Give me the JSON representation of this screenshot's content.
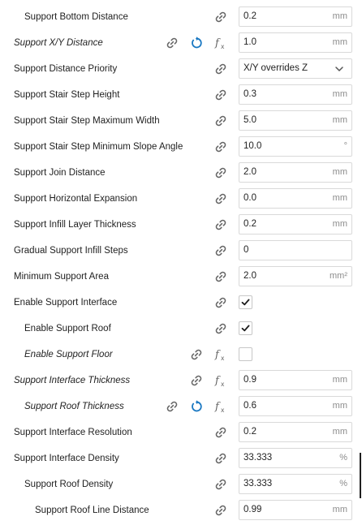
{
  "settings": [
    {
      "label": "Support Bottom Distance",
      "indent": 1,
      "italic": false,
      "icons": [
        "link"
      ],
      "control": "number",
      "value": "0.2",
      "unit": "mm"
    },
    {
      "label": "Support X/Y Distance",
      "indent": 0,
      "italic": true,
      "icons": [
        "per-extruder",
        "reset",
        "formula",
        "link"
      ],
      "control": "number",
      "value": "1.0",
      "unit": "mm"
    },
    {
      "label": "Support Distance Priority",
      "indent": 0,
      "italic": false,
      "icons": [
        "link"
      ],
      "control": "select",
      "value": "X/Y overrides Z",
      "unit": ""
    },
    {
      "label": "Support Stair Step Height",
      "indent": 0,
      "italic": false,
      "icons": [
        "link"
      ],
      "control": "number",
      "value": "0.3",
      "unit": "mm"
    },
    {
      "label": "Support Stair Step Maximum Width",
      "indent": 0,
      "italic": false,
      "icons": [
        "link"
      ],
      "control": "number",
      "value": "5.0",
      "unit": "mm"
    },
    {
      "label": "Support Stair Step Minimum Slope Angle",
      "indent": 0,
      "italic": false,
      "icons": [
        "link"
      ],
      "control": "number",
      "value": "10.0",
      "unit": "°"
    },
    {
      "label": "Support Join Distance",
      "indent": 0,
      "italic": false,
      "icons": [
        "link"
      ],
      "control": "number",
      "value": "2.0",
      "unit": "mm"
    },
    {
      "label": "Support Horizontal Expansion",
      "indent": 0,
      "italic": false,
      "icons": [
        "link"
      ],
      "control": "number",
      "value": "0.0",
      "unit": "mm"
    },
    {
      "label": "Support Infill Layer Thickness",
      "indent": 0,
      "italic": false,
      "icons": [
        "link"
      ],
      "control": "number",
      "value": "0.2",
      "unit": "mm"
    },
    {
      "label": "Gradual Support Infill Steps",
      "indent": 0,
      "italic": false,
      "icons": [
        "link"
      ],
      "control": "number",
      "value": "0",
      "unit": ""
    },
    {
      "label": "Minimum Support Area",
      "indent": 0,
      "italic": false,
      "icons": [
        "link"
      ],
      "control": "number",
      "value": "2.0",
      "unit": "mm²"
    },
    {
      "label": "Enable Support Interface",
      "indent": 0,
      "italic": false,
      "icons": [
        "link"
      ],
      "control": "checkbox",
      "checked": true
    },
    {
      "label": "Enable Support Roof",
      "indent": 1,
      "italic": false,
      "icons": [
        "link"
      ],
      "control": "checkbox",
      "checked": true
    },
    {
      "label": "Enable Support Floor",
      "indent": 1,
      "italic": true,
      "icons": [
        "per-extruder",
        "formula"
      ],
      "control": "checkbox",
      "checked": false
    },
    {
      "label": "Support Interface Thickness",
      "indent": 0,
      "italic": true,
      "icons": [
        "per-extruder",
        "formula"
      ],
      "control": "number",
      "value": "0.9",
      "unit": "mm"
    },
    {
      "label": "Support Roof Thickness",
      "indent": 1,
      "italic": true,
      "icons": [
        "per-extruder",
        "reset",
        "formula"
      ],
      "control": "number",
      "value": "0.6",
      "unit": "mm"
    },
    {
      "label": "Support Interface Resolution",
      "indent": 0,
      "italic": false,
      "icons": [
        "link"
      ],
      "control": "number",
      "value": "0.2",
      "unit": "mm"
    },
    {
      "label": "Support Interface Density",
      "indent": 0,
      "italic": false,
      "icons": [
        "link"
      ],
      "control": "number",
      "value": "33.333",
      "unit": "%"
    },
    {
      "label": "Support Roof Density",
      "indent": 1,
      "italic": false,
      "icons": [
        "link"
      ],
      "control": "number",
      "value": "33.333",
      "unit": "%"
    },
    {
      "label": "Support Roof Line Distance",
      "indent": 2,
      "italic": false,
      "icons": [
        "link"
      ],
      "control": "number",
      "value": "0.99",
      "unit": "mm"
    }
  ],
  "colors": {
    "reset_icon": "#1a78c2",
    "icon": "#666666",
    "checkmark": "#1f1f1f"
  }
}
